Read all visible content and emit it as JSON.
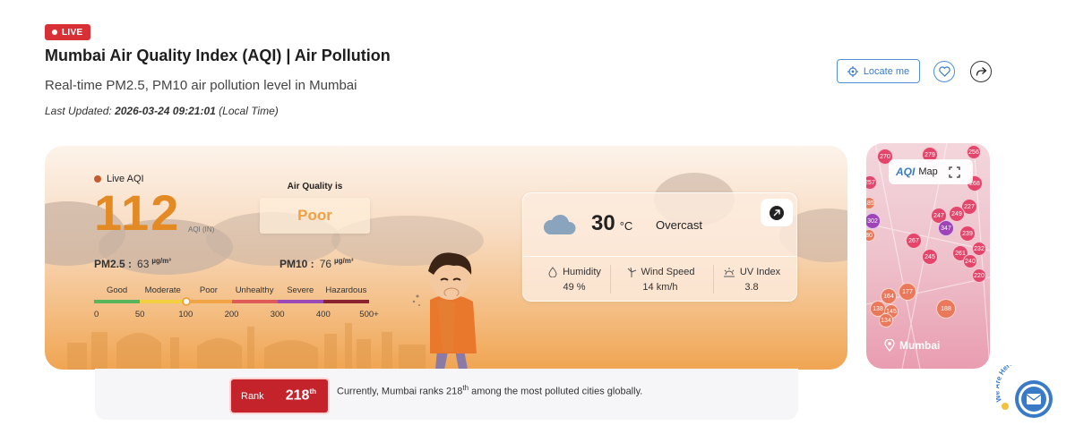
{
  "header": {
    "live_badge": "LIVE",
    "title": "Mumbai Air Quality Index (AQI) | Air Pollution",
    "subtitle": "Real-time PM2.5, PM10 air pollution level in Mumbai",
    "last_updated_label": "Last Updated:",
    "last_updated_value": "2026-03-24 09:21:01",
    "last_updated_suffix": "(Local Time)",
    "locate_label": "Locate me"
  },
  "aqi": {
    "live_label": "Live AQI",
    "value": "112",
    "unit": "AQI (IN)",
    "status_heading": "Air Quality is",
    "status": "Poor",
    "pm25_label": "PM2.5 :",
    "pm25_value": "63",
    "pm10_label": "PM10 :",
    "pm10_value": "76",
    "pm_unit": "µg/m³",
    "level_fraction": 0.224,
    "scale_labels": [
      "Good",
      "Moderate",
      "Poor",
      "Unhealthy",
      "Severe",
      "Hazardous"
    ],
    "scale_numbers": [
      "0",
      "50",
      "100",
      "200",
      "300",
      "400",
      "500+"
    ],
    "scale_colors": [
      "#59b55a",
      "#f2cf3e",
      "#f2a345",
      "#e15a5a",
      "#9c4ab5",
      "#8b2230"
    ]
  },
  "weather": {
    "temperature": "30",
    "temp_unit": "°C",
    "condition": "Overcast",
    "humidity_label": "Humidity",
    "humidity_value": "49 %",
    "wind_label": "Wind Speed",
    "wind_value": "14 km/h",
    "uv_label": "UV Index",
    "uv_value": "3.8"
  },
  "map": {
    "logo": "AQI",
    "label": "Map",
    "city": "Mumbai",
    "bubbles": [
      "270",
      "279",
      "256",
      "257",
      "268",
      "227",
      "302",
      "247",
      "249",
      "347",
      "239",
      "267",
      "245",
      "261",
      "232",
      "240",
      "220",
      "177",
      "164",
      "138",
      "145",
      "134",
      "188",
      "185",
      "80"
    ]
  },
  "rank": {
    "label": "Rank",
    "value": "218",
    "suffix": "th",
    "text_before": "Currently, Mumbai ranks 218",
    "text_after": " among the most polluted cities globally."
  },
  "contact": {
    "label": "We Are Here!"
  },
  "colors": {
    "live_red": "#d93036",
    "aqi_orange": "#e38a25",
    "poor_orange": "#f0a044",
    "accent_blue": "#3a7bc8",
    "rank_red": "#c4232c"
  }
}
